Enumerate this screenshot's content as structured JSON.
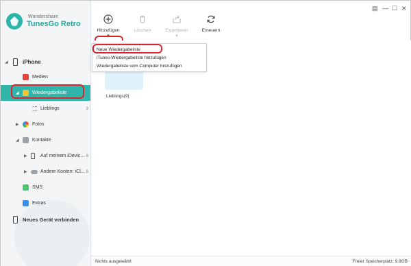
{
  "app": {
    "brand_small": "Wondershare",
    "brand_name": "TunesGo Retro",
    "accent": "#2fb5a9"
  },
  "toolbar": {
    "add_label": "Hinzufügen",
    "delete_label": "Löschen",
    "export_label": "Exportieren",
    "refresh_label": "Erneuern"
  },
  "dropdown": {
    "items": [
      "Neue Wiedergabeliste",
      "iTunes-Wiedergabeliste hinzufügen",
      "Wiedergabeliste vom Computer hinzufügen"
    ]
  },
  "sidebar": {
    "device": "iPhone",
    "items": [
      {
        "label": "Medien",
        "icon": "music-icon"
      },
      {
        "label": "Wiedergabeliste",
        "icon": "playlist-icon"
      },
      {
        "label": "Lieblings",
        "count": "9"
      },
      {
        "label": "Fotos",
        "icon": "photos-icon"
      },
      {
        "label": "Kontakte",
        "icon": "contacts-icon"
      },
      {
        "label": "Auf meinem iDevic...",
        "count": "6"
      },
      {
        "label": "Andere Konten: iCl...",
        "count": "6"
      },
      {
        "label": "SMS",
        "icon": "sms-icon"
      },
      {
        "label": "Extras",
        "icon": "extras-icon"
      }
    ],
    "connect_label": "Neues Gerät verbinden"
  },
  "content": {
    "tile_label": "Lieblings(9)"
  },
  "status": {
    "left": "Nichts ausgewählt",
    "right": "Freier Speicherplatz: 9.9GB"
  },
  "window": {
    "close_glyph": "✕",
    "maximize_glyph": "☐",
    "minimize_glyph": "—",
    "menu_glyph": "▤"
  }
}
